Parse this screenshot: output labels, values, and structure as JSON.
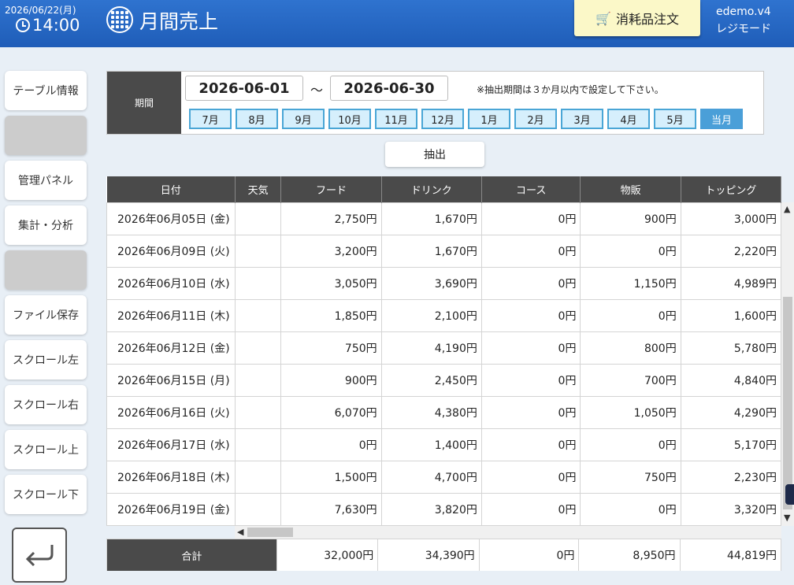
{
  "header": {
    "date": "2026/06/22(月)",
    "time": "14:00",
    "title": "月間売上",
    "order_button": "消耗品注文",
    "store_name": "edemo.v4",
    "mode": "レジモード"
  },
  "sidebar": {
    "items": [
      {
        "label": "テーブル情報"
      },
      {
        "label": ""
      },
      {
        "label": "管理パネル"
      },
      {
        "label": "集計・分析"
      },
      {
        "label": ""
      },
      {
        "label": "ファイル保存"
      },
      {
        "label": "スクロール左"
      },
      {
        "label": "スクロール右"
      },
      {
        "label": "スクロール上"
      },
      {
        "label": "スクロール下"
      }
    ]
  },
  "period": {
    "label": "期間",
    "start": "2026-06-01",
    "end": "2026-06-30",
    "separator": "～",
    "note": "※抽出期間は３か月以内で設定して下さい。",
    "months": [
      "7月",
      "8月",
      "9月",
      "10月",
      "11月",
      "12月",
      "1月",
      "2月",
      "3月",
      "4月",
      "5月",
      "当月"
    ],
    "active_month": "当月"
  },
  "extract_button": "抽出",
  "table": {
    "columns": [
      "日付",
      "天気",
      "フード",
      "ドリンク",
      "コース",
      "物販",
      "トッピング"
    ],
    "rows": [
      [
        "2026年06月05日 (金)",
        "",
        "2,750円",
        "1,670円",
        "0円",
        "900円",
        "3,000円"
      ],
      [
        "2026年06月09日 (火)",
        "",
        "3,200円",
        "1,670円",
        "0円",
        "0円",
        "2,220円"
      ],
      [
        "2026年06月10日 (水)",
        "",
        "3,050円",
        "3,690円",
        "0円",
        "1,150円",
        "4,989円"
      ],
      [
        "2026年06月11日 (木)",
        "",
        "1,850円",
        "2,100円",
        "0円",
        "0円",
        "1,600円"
      ],
      [
        "2026年06月12日 (金)",
        "",
        "750円",
        "4,190円",
        "0円",
        "800円",
        "5,780円"
      ],
      [
        "2026年06月15日 (月)",
        "",
        "900円",
        "2,450円",
        "0円",
        "700円",
        "4,840円"
      ],
      [
        "2026年06月16日 (火)",
        "",
        "6,070円",
        "4,380円",
        "0円",
        "1,050円",
        "4,290円"
      ],
      [
        "2026年06月17日 (水)",
        "",
        "0円",
        "1,400円",
        "0円",
        "0円",
        "5,170円"
      ],
      [
        "2026年06月18日 (木)",
        "",
        "1,500円",
        "4,700円",
        "0円",
        "750円",
        "2,230円"
      ],
      [
        "2026年06月19日 (金)",
        "",
        "7,630円",
        "3,820円",
        "0円",
        "0円",
        "3,320円"
      ]
    ],
    "totals": {
      "label": "合計",
      "values": [
        "32,000円",
        "34,390円",
        "0円",
        "8,950円",
        "44,819円"
      ]
    }
  },
  "colors": {
    "header_bg": "#2467c4",
    "order_button_bg": "#fbf8c8",
    "table_header_bg": "#4a4a4a",
    "month_button_bg": "#d6effc",
    "month_active_bg": "#4a9fd8"
  }
}
